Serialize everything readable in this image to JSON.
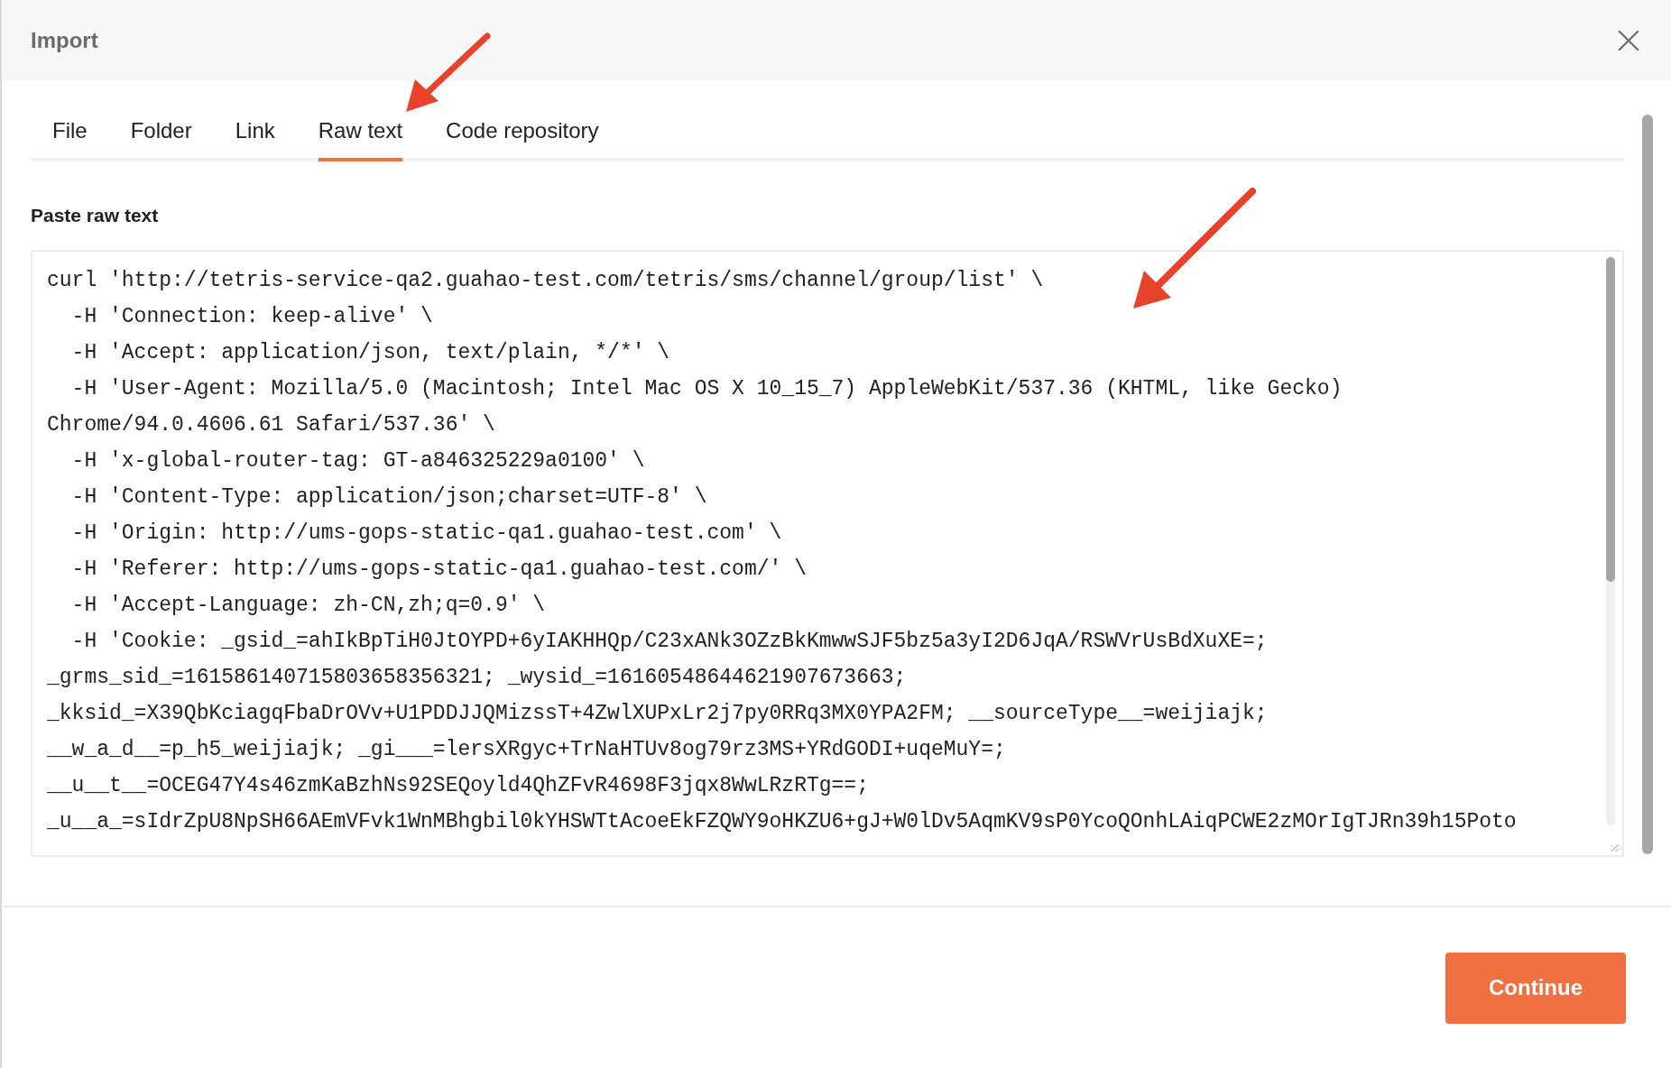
{
  "dialog": {
    "title": "Import"
  },
  "tabs": [
    {
      "label": "File",
      "selected": false
    },
    {
      "label": "Folder",
      "selected": false
    },
    {
      "label": "Link",
      "selected": false
    },
    {
      "label": "Raw text",
      "selected": true
    },
    {
      "label": "Code repository",
      "selected": false
    }
  ],
  "raw_text": {
    "label": "Paste raw text",
    "lines": [
      "curl 'http://tetris-service-qa2.guahao-test.com/tetris/sms/channel/group/list' \\",
      "  -H 'Connection: keep-alive' \\",
      "  -H 'Accept: application/json, text/plain, */*' \\",
      "  -H 'User-Agent: Mozilla/5.0 (Macintosh; Intel Mac OS X 10_15_7) AppleWebKit/537.36 (KHTML, like Gecko)",
      "Chrome/94.0.4606.61 Safari/537.36' \\",
      "  -H 'x-global-router-tag: GT-a846325229a0100' \\",
      "  -H 'Content-Type: application/json;charset=UTF-8' \\",
      "  -H 'Origin: http://ums-gops-static-qa1.guahao-test.com' \\",
      "  -H 'Referer: http://ums-gops-static-qa1.guahao-test.com/' \\",
      "  -H 'Accept-Language: zh-CN,zh;q=0.9' \\",
      "  -H 'Cookie: _gsid_=ahIkBpTiH0JtOYPD+6yIAKHHQp/C23xANk3OZzBkKmwwSJF5bz5a3yI2D6JqA/RSWVrUsBdXuXE=;",
      "_grms_sid_=161586140715803658356321; _wysid_=16160548644621907673663;",
      "_kksid_=X39QbKciagqFbaDrOVv+U1PDDJJQMizssT+4ZwlXUPxLr2j7py0RRq3MX0YPA2FM; __sourceType__=weijiajk;",
      "__w_a_d__=p_h5_weijiajk; _gi___=lersXRgyc+TrNaHTUv8og79rz3MS+YRdGODI+uqeMuY=;",
      "__u__t__=OCEG47Y4s46zmKaBzhNs92SEQoyld4QhZFvR4698F3jqx8WwLRzRTg==;",
      "_u__a_=sIdrZpU8NpSH66AEmVFvk1WnMBhgbil0kYHSWTtAcoeEkFZQWY9oHKZU6+gJ+W0lDv5AqmKV9sP0YcoQOnhLAiqPCWE2zMOrIgTJRn39h15Poto"
    ]
  },
  "footer": {
    "button": "Continue"
  }
}
